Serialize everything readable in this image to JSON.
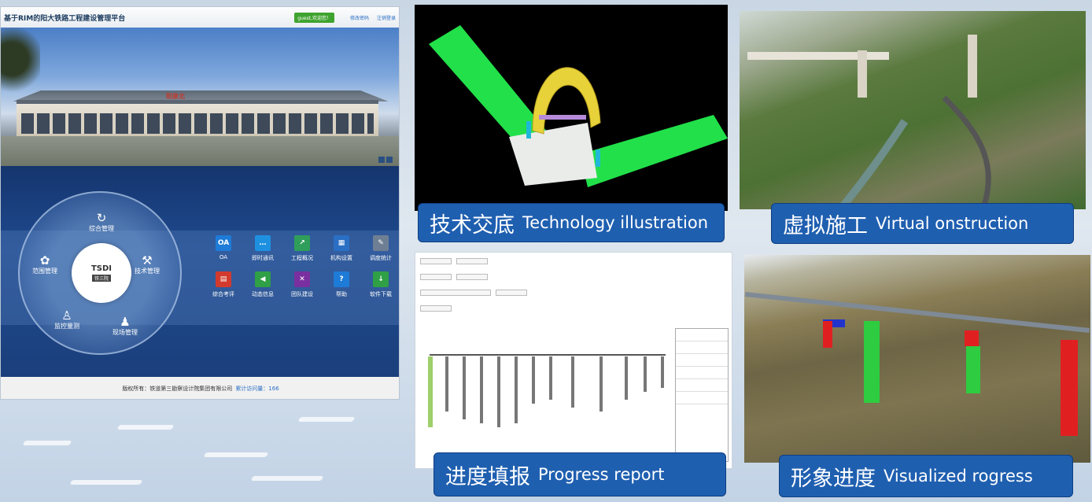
{
  "platform": {
    "title": "基于RIM的阳大铁路工程建设管理平台",
    "user_badge": "guest,欢迎您！",
    "change_password": "修改密码",
    "logout": "注销登录",
    "station_name": "阳泉北",
    "wheel": {
      "items": [
        {
          "label": "综合管理",
          "icon": "refresh-icon"
        },
        {
          "label": "范围管理",
          "icon": "gears-icon"
        },
        {
          "label": "技术管理",
          "icon": "tools-icon"
        },
        {
          "label": "监控量测",
          "icon": "surveyor-icon"
        },
        {
          "label": "现场管理",
          "icon": "worker-icon"
        }
      ],
      "hub_logo": "TSDI",
      "hub_sub": "铁三院"
    },
    "apps": [
      {
        "label": "OA",
        "glyph": "OA",
        "color": "#1e7bd8"
      },
      {
        "label": "即时通讯",
        "glyph": "…",
        "color": "#1e90e0"
      },
      {
        "label": "工程概况",
        "glyph": "↗",
        "color": "#2e9e5a"
      },
      {
        "label": "机构设置",
        "glyph": "▦",
        "color": "#2a6fc4"
      },
      {
        "label": "调度统计",
        "glyph": "✎",
        "color": "#6f7f93"
      },
      {
        "label": "综合考评",
        "glyph": "▤",
        "color": "#d23a2e"
      },
      {
        "label": "动态信息",
        "glyph": "◀",
        "color": "#2fa045"
      },
      {
        "label": "团队建设",
        "glyph": "✕",
        "color": "#7a2fa0"
      },
      {
        "label": "帮助",
        "glyph": "?",
        "color": "#1e7bd8"
      },
      {
        "label": "软件下载",
        "glyph": "↓",
        "color": "#2fa045"
      }
    ],
    "footer_text": "版权所有：铁道第三勘察设计院集团有限公司",
    "visit_label": "累计访问量：166"
  },
  "panels": {
    "tech": {
      "cn": "技术交底",
      "en": "Technology illustration"
    },
    "virtual": {
      "cn": "虚拟施工",
      "en": "Virtual onstruction"
    },
    "progress": {
      "cn": "进度填报",
      "en": "Progress report"
    },
    "visual": {
      "cn": "形象进度",
      "en": "Visualized rogress"
    }
  }
}
